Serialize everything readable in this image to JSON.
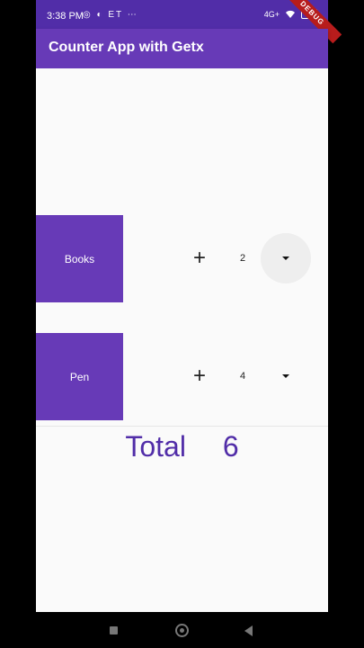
{
  "status_bar": {
    "time": "3:38 PM",
    "left_icons": "◎ ◐ ET ⋯",
    "right_text": "4G+",
    "battery": "18"
  },
  "debug_banner": "DEBUG",
  "app_bar": {
    "title": "Counter App with Getx"
  },
  "products": [
    {
      "name": "Books",
      "count": "2",
      "plus": "+"
    },
    {
      "name": "Pen",
      "count": "4",
      "plus": "+"
    }
  ],
  "total": {
    "label": "Total",
    "value": "6"
  },
  "colors": {
    "primary": "#673ab7",
    "primary_dark": "#512da8",
    "debug": "#b71c1c",
    "background": "#fafafa"
  },
  "icons": {
    "increment": "plus-icon",
    "decrement": "arrow-drop-down-icon",
    "nav": [
      "recents-square-icon",
      "home-circle-icon",
      "back-triangle-icon"
    ]
  }
}
